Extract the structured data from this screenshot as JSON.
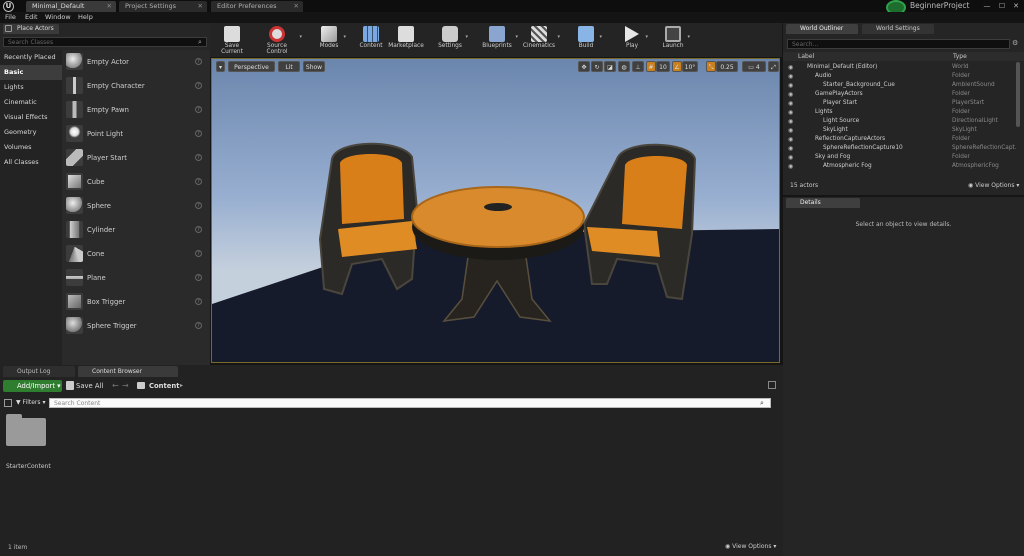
{
  "titlebar": {
    "tabs": [
      "Minimal_Default",
      "Project Settings",
      "Editor Preferences"
    ],
    "project_name": "BeginnerProject"
  },
  "menu": [
    "File",
    "Edit",
    "Window",
    "Help"
  ],
  "place_actors": {
    "tab_label": "Place Actors",
    "search_placeholder": "Search Classes",
    "categories": [
      "Recently Placed",
      "Basic",
      "Lights",
      "Cinematic",
      "Visual Effects",
      "Geometry",
      "Volumes",
      "All Classes"
    ],
    "selected_category": "Basic",
    "items": [
      {
        "label": "Empty Actor",
        "icon": "sphere-icon"
      },
      {
        "label": "Empty Character",
        "icon": "character-icon"
      },
      {
        "label": "Empty Pawn",
        "icon": "pawn-icon"
      },
      {
        "label": "Point Light",
        "icon": "light-bulb-icon"
      },
      {
        "label": "Player Start",
        "icon": "player-start-icon"
      },
      {
        "label": "Cube",
        "icon": "cube-icon"
      },
      {
        "label": "Sphere",
        "icon": "sphere-icon"
      },
      {
        "label": "Cylinder",
        "icon": "cylinder-icon"
      },
      {
        "label": "Cone",
        "icon": "cone-icon"
      },
      {
        "label": "Plane",
        "icon": "plane-icon"
      },
      {
        "label": "Box Trigger",
        "icon": "box-trigger-icon"
      },
      {
        "label": "Sphere Trigger",
        "icon": "sphere-trigger-icon"
      }
    ]
  },
  "toolbar": [
    {
      "label": "Save Current",
      "icon": "save-icon"
    },
    {
      "label": "Source Control",
      "icon": "source-control-icon"
    },
    {
      "label": "Modes",
      "icon": "modes-icon"
    },
    {
      "label": "Content",
      "icon": "content-icon"
    },
    {
      "label": "Marketplace",
      "icon": "marketplace-icon"
    },
    {
      "label": "Settings",
      "icon": "settings-icon"
    },
    {
      "label": "Blueprints",
      "icon": "blueprints-icon"
    },
    {
      "label": "Cinematics",
      "icon": "cinematics-icon"
    },
    {
      "label": "Build",
      "icon": "build-icon"
    },
    {
      "label": "Play",
      "icon": "play-icon"
    },
    {
      "label": "Launch",
      "icon": "launch-icon"
    }
  ],
  "viewport": {
    "perspective_label": "Perspective",
    "lit_label": "Lit",
    "show_label": "Show",
    "grid_snap": "10",
    "rotation_snap": "10°",
    "scale_snap": "0.25",
    "camera_speed": "4"
  },
  "bottom": {
    "tabs": [
      "Output Log",
      "Content Browser"
    ],
    "add_import_label": "Add/Import",
    "save_all_label": "Save All",
    "breadcrumb": "Content",
    "filters_label": "Filters",
    "search_placeholder": "Search Content",
    "folder_name": "StarterContent",
    "item_count": "1 item",
    "view_options_label": "View Options"
  },
  "outliner": {
    "tabs": [
      "World Outliner",
      "World Settings"
    ],
    "search_placeholder": "Search...",
    "col_label": "Label",
    "col_type": "Type",
    "rows": [
      {
        "label": "Minimal_Default (Editor)",
        "type": "World",
        "indent": 0
      },
      {
        "label": "Audio",
        "type": "Folder",
        "indent": 1
      },
      {
        "label": "Starter_Background_Cue",
        "type": "AmbientSound",
        "indent": 2
      },
      {
        "label": "GamePlayActors",
        "type": "Folder",
        "indent": 1
      },
      {
        "label": "Player Start",
        "type": "PlayerStart",
        "indent": 2
      },
      {
        "label": "Lights",
        "type": "Folder",
        "indent": 1
      },
      {
        "label": "Light Source",
        "type": "DirectionalLight",
        "indent": 2
      },
      {
        "label": "SkyLight",
        "type": "SkyLight",
        "indent": 2
      },
      {
        "label": "ReflectionCaptureActors",
        "type": "Folder",
        "indent": 1
      },
      {
        "label": "SphereReflectionCapture10",
        "type": "SphereReflectionCapt.",
        "indent": 2
      },
      {
        "label": "Sky and Fog",
        "type": "Folder",
        "indent": 1
      },
      {
        "label": "Atmospheric Fog",
        "type": "AtmosphericFog",
        "indent": 2
      }
    ],
    "actor_count": "15 actors",
    "view_options_label": "View Options"
  },
  "details": {
    "tab_label": "Details",
    "empty_message": "Select an object to view details."
  }
}
